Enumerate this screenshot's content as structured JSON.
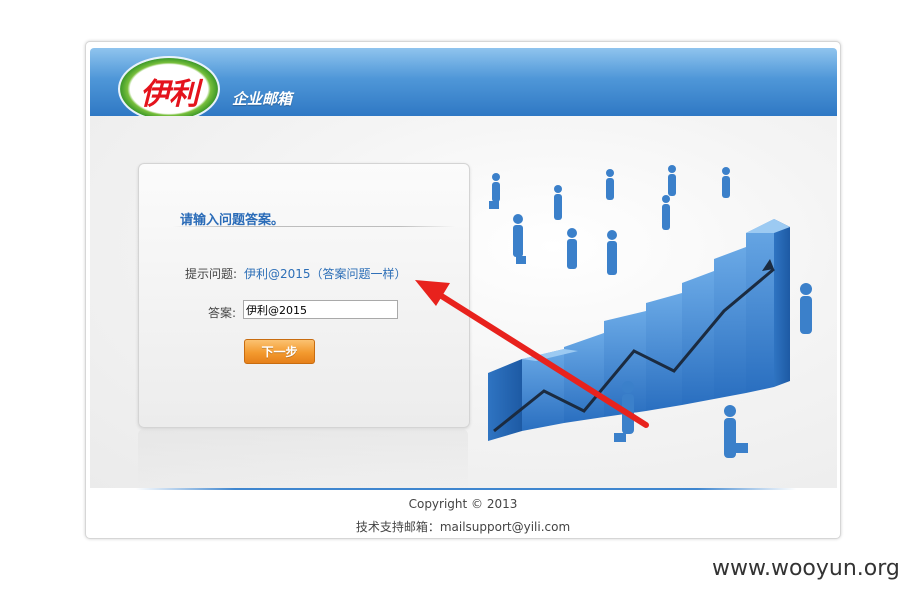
{
  "header": {
    "logo_text": "伊利",
    "title": "企业邮箱"
  },
  "form": {
    "title": "请输入问题答案。",
    "hint_label": "提示问题:",
    "hint_value": "伊利@2015（答案问题一样）",
    "answer_label": "答案:",
    "answer_value": "伊利@2015",
    "next_button": "下一步"
  },
  "footer": {
    "copyright": "Copyright © 2013",
    "support": "技术支持邮箱：mailsupport@yili.com"
  },
  "watermark": "www.wooyun.org",
  "colors": {
    "header_blue": "#4f97d8",
    "link_blue": "#2d6fb7",
    "button_orange": "#f39a2f",
    "arrow_red": "#e8221d"
  }
}
